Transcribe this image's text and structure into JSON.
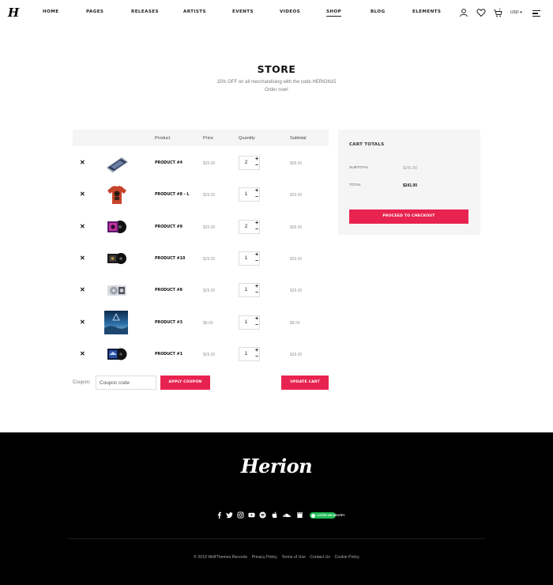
{
  "header": {
    "logo": "H",
    "nav": [
      {
        "label": "Home",
        "active": false
      },
      {
        "label": "Pages",
        "active": false
      },
      {
        "label": "Releases",
        "active": false
      },
      {
        "label": "Artists",
        "active": false
      },
      {
        "label": "Events",
        "active": false
      },
      {
        "label": "Videos",
        "active": false
      },
      {
        "label": "Shop",
        "active": true
      },
      {
        "label": "Blog",
        "active": false
      },
      {
        "label": "Elements",
        "active": false
      }
    ],
    "cart_count": "7",
    "currency": "USD"
  },
  "page": {
    "title": "STORE",
    "subtitle_line1": "15% OFF on all merchandising with the code HERION15",
    "subtitle_line2": "Order now!"
  },
  "cart": {
    "headers": {
      "product": "Product",
      "price": "Price",
      "quantity": "Quantity",
      "subtotal": "Subtotal"
    },
    "items": [
      {
        "name": "PRODUCT #4",
        "price": "$29.00",
        "quantity": "2",
        "subtotal": "$58.00",
        "thumb": "cd-case-image"
      },
      {
        "name": "PRODUCT #8 - L",
        "price": "$29.00",
        "quantity": "1",
        "subtotal": "$29.00",
        "thumb": "red-tshirt-image"
      },
      {
        "name": "PRODUCT #9",
        "price": "$29.00",
        "quantity": "2",
        "subtotal": "$58.00",
        "thumb": "vinyl-purple-image"
      },
      {
        "name": "PRODUCT #10",
        "price": "$29.00",
        "quantity": "1",
        "subtotal": "$29.00",
        "thumb": "vinyl-dark-image"
      },
      {
        "name": "PRODUCT #8",
        "price": "$29.00",
        "quantity": "1",
        "subtotal": "$29.00",
        "thumb": "cd-white-image"
      },
      {
        "name": "PRODUCT #3",
        "price": "$8.00",
        "quantity": "1",
        "subtotal": "$8.00",
        "thumb": "album-cover-image"
      },
      {
        "name": "PRODUCT #1",
        "price": "$29.00",
        "quantity": "1",
        "subtotal": "$29.00",
        "thumb": "vinyl-blue-image"
      }
    ],
    "coupon_label": "Coupon:",
    "coupon_placeholder": "Coupon code",
    "apply_coupon": "Apply coupon",
    "update_cart": "Update cart"
  },
  "totals": {
    "title": "CART TOTALS",
    "subtotal_label": "Subtotal",
    "subtotal_value": "$241.00",
    "total_label": "Total",
    "total_value": "$241.00",
    "checkout": "Proceed to checkout"
  },
  "footer": {
    "logo": "Herion",
    "socials": [
      "facebook-icon",
      "twitter-icon",
      "instagram-icon",
      "youtube-icon",
      "spotify-icon",
      "apple-icon",
      "soundcloud-icon",
      "bandcamp-icon"
    ],
    "spotify_badge": "LISTEN ON SPOTIFY",
    "copyright": "© 2019 WolfThemes Records",
    "links": [
      "Privacy Policy",
      "Terms of Use",
      "Contact Us",
      "Cookie Policy"
    ]
  },
  "colors": {
    "accent": "#e9234f",
    "footer_bg": "#000000",
    "panel_bg": "#f5f5f5"
  }
}
